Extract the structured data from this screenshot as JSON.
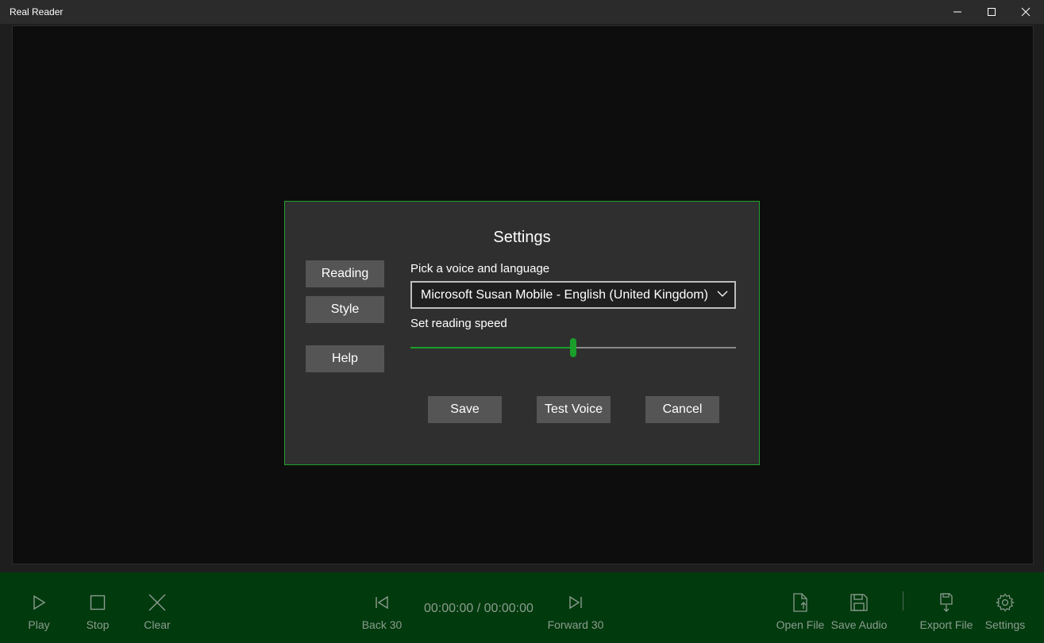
{
  "window": {
    "title": "Real Reader"
  },
  "settings_dialog": {
    "title": "Settings",
    "side_buttons": {
      "reading": "Reading",
      "style": "Style",
      "help": "Help"
    },
    "voice_label": "Pick a voice and language",
    "voice_selected": "Microsoft Susan Mobile - English (United Kingdom)",
    "speed_label": "Set reading speed",
    "speed_value_fraction": 0.5,
    "buttons": {
      "save": "Save",
      "test_voice": "Test Voice",
      "cancel": "Cancel"
    }
  },
  "command_bar": {
    "play": "Play",
    "stop": "Stop",
    "clear": "Clear",
    "back": "Back 30",
    "time": "00:00:00 / 00:00:00",
    "forward": "Forward 30",
    "open_file": "Open File",
    "save_audio": "Save Audio",
    "export_file": "Export File",
    "settings": "Settings"
  },
  "colors": {
    "accent_green": "#1a9f2b",
    "command_bar_bg": "#003a0d",
    "dialog_bg": "#2f2f2f",
    "icon_muted": "#8c9c8f"
  },
  "icons": {
    "play": "play-icon",
    "stop": "stop-icon",
    "clear": "close-icon",
    "back": "skip-back-icon",
    "forward": "skip-forward-icon",
    "open_file": "file-open-icon",
    "save_audio": "floppy-disk-icon",
    "export_file": "export-icon",
    "settings": "gear-icon"
  }
}
